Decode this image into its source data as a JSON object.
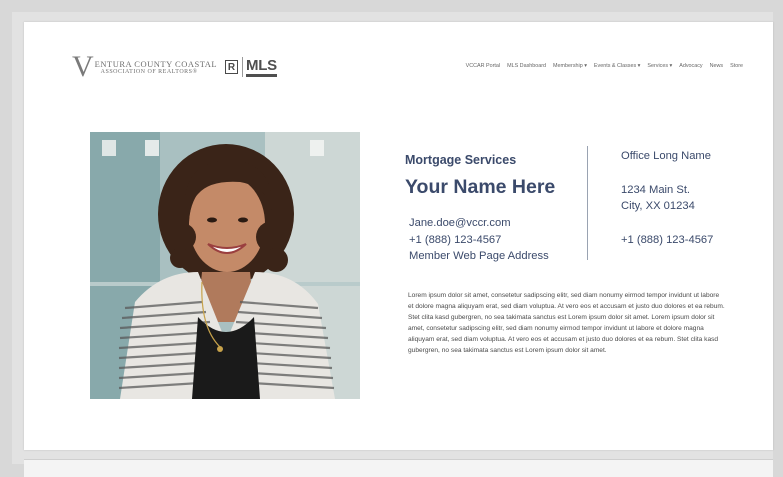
{
  "header": {
    "logo": {
      "initial": "V",
      "line1": "ENTURA COUNTY COASTAL",
      "line2": "ASSOCIATION OF REALTORS®",
      "mark_r": "R",
      "mark_mls": "MLS"
    },
    "nav": [
      {
        "label": "VCCAR Portal"
      },
      {
        "label": "MLS Dashboard"
      },
      {
        "label": "Membership ▾"
      },
      {
        "label": "Events & Classes ▾"
      },
      {
        "label": "Services ▾"
      },
      {
        "label": "Advocacy"
      },
      {
        "label": "News"
      },
      {
        "label": "Store"
      }
    ]
  },
  "profile": {
    "service": "Mortgage Services",
    "name": "Your Name Here",
    "email": "Jane.doe@vccr.com",
    "phone": "+1 (888) 123-4567",
    "web": "Member Web Page Address"
  },
  "office": {
    "name": "Office Long Name",
    "address_line1": "1234 Main St.",
    "address_line2": "City, XX 01234",
    "phone": "+1 (888) 123-4567"
  },
  "bio": "Lorem ipsum dolor sit amet, consetetur sadipscing elitr, sed diam nonumy eirmod tempor invidunt ut labore et dolore magna aliquyam erat, sed diam voluptua. At vero eos et accusam et justo duo dolores et ea rebum. Stet clita kasd gubergren, no sea takimata sanctus est Lorem ipsum dolor sit amet. Lorem ipsum dolor sit amet, consetetur sadipscing elitr, sed diam nonumy eirmod tempor invidunt ut labore et dolore magna aliquyam erat, sed diam voluptua. At vero eos et accusam et justo duo dolores et ea rebum. Stet clita kasd gubergren, no sea takimata sanctus est Lorem ipsum dolor sit amet.",
  "colors": {
    "text_primary": "#3b4a6b",
    "nav_text": "#666666"
  }
}
